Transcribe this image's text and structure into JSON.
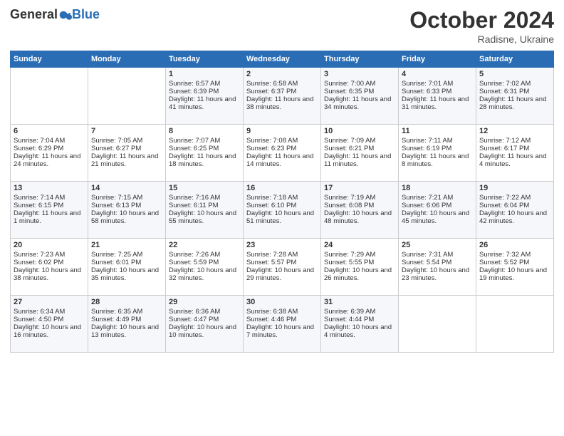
{
  "header": {
    "logo_general": "General",
    "logo_blue": "Blue",
    "month_title": "October 2024",
    "location": "Radisne, Ukraine"
  },
  "days_of_week": [
    "Sunday",
    "Monday",
    "Tuesday",
    "Wednesday",
    "Thursday",
    "Friday",
    "Saturday"
  ],
  "weeks": [
    [
      {
        "day": "",
        "sunrise": "",
        "sunset": "",
        "daylight": ""
      },
      {
        "day": "",
        "sunrise": "",
        "sunset": "",
        "daylight": ""
      },
      {
        "day": "1",
        "sunrise": "Sunrise: 6:57 AM",
        "sunset": "Sunset: 6:39 PM",
        "daylight": "Daylight: 11 hours and 41 minutes."
      },
      {
        "day": "2",
        "sunrise": "Sunrise: 6:58 AM",
        "sunset": "Sunset: 6:37 PM",
        "daylight": "Daylight: 11 hours and 38 minutes."
      },
      {
        "day": "3",
        "sunrise": "Sunrise: 7:00 AM",
        "sunset": "Sunset: 6:35 PM",
        "daylight": "Daylight: 11 hours and 34 minutes."
      },
      {
        "day": "4",
        "sunrise": "Sunrise: 7:01 AM",
        "sunset": "Sunset: 6:33 PM",
        "daylight": "Daylight: 11 hours and 31 minutes."
      },
      {
        "day": "5",
        "sunrise": "Sunrise: 7:02 AM",
        "sunset": "Sunset: 6:31 PM",
        "daylight": "Daylight: 11 hours and 28 minutes."
      }
    ],
    [
      {
        "day": "6",
        "sunrise": "Sunrise: 7:04 AM",
        "sunset": "Sunset: 6:29 PM",
        "daylight": "Daylight: 11 hours and 24 minutes."
      },
      {
        "day": "7",
        "sunrise": "Sunrise: 7:05 AM",
        "sunset": "Sunset: 6:27 PM",
        "daylight": "Daylight: 11 hours and 21 minutes."
      },
      {
        "day": "8",
        "sunrise": "Sunrise: 7:07 AM",
        "sunset": "Sunset: 6:25 PM",
        "daylight": "Daylight: 11 hours and 18 minutes."
      },
      {
        "day": "9",
        "sunrise": "Sunrise: 7:08 AM",
        "sunset": "Sunset: 6:23 PM",
        "daylight": "Daylight: 11 hours and 14 minutes."
      },
      {
        "day": "10",
        "sunrise": "Sunrise: 7:09 AM",
        "sunset": "Sunset: 6:21 PM",
        "daylight": "Daylight: 11 hours and 11 minutes."
      },
      {
        "day": "11",
        "sunrise": "Sunrise: 7:11 AM",
        "sunset": "Sunset: 6:19 PM",
        "daylight": "Daylight: 11 hours and 8 minutes."
      },
      {
        "day": "12",
        "sunrise": "Sunrise: 7:12 AM",
        "sunset": "Sunset: 6:17 PM",
        "daylight": "Daylight: 11 hours and 4 minutes."
      }
    ],
    [
      {
        "day": "13",
        "sunrise": "Sunrise: 7:14 AM",
        "sunset": "Sunset: 6:15 PM",
        "daylight": "Daylight: 11 hours and 1 minute."
      },
      {
        "day": "14",
        "sunrise": "Sunrise: 7:15 AM",
        "sunset": "Sunset: 6:13 PM",
        "daylight": "Daylight: 10 hours and 58 minutes."
      },
      {
        "day": "15",
        "sunrise": "Sunrise: 7:16 AM",
        "sunset": "Sunset: 6:11 PM",
        "daylight": "Daylight: 10 hours and 55 minutes."
      },
      {
        "day": "16",
        "sunrise": "Sunrise: 7:18 AM",
        "sunset": "Sunset: 6:10 PM",
        "daylight": "Daylight: 10 hours and 51 minutes."
      },
      {
        "day": "17",
        "sunrise": "Sunrise: 7:19 AM",
        "sunset": "Sunset: 6:08 PM",
        "daylight": "Daylight: 10 hours and 48 minutes."
      },
      {
        "day": "18",
        "sunrise": "Sunrise: 7:21 AM",
        "sunset": "Sunset: 6:06 PM",
        "daylight": "Daylight: 10 hours and 45 minutes."
      },
      {
        "day": "19",
        "sunrise": "Sunrise: 7:22 AM",
        "sunset": "Sunset: 6:04 PM",
        "daylight": "Daylight: 10 hours and 42 minutes."
      }
    ],
    [
      {
        "day": "20",
        "sunrise": "Sunrise: 7:23 AM",
        "sunset": "Sunset: 6:02 PM",
        "daylight": "Daylight: 10 hours and 38 minutes."
      },
      {
        "day": "21",
        "sunrise": "Sunrise: 7:25 AM",
        "sunset": "Sunset: 6:01 PM",
        "daylight": "Daylight: 10 hours and 35 minutes."
      },
      {
        "day": "22",
        "sunrise": "Sunrise: 7:26 AM",
        "sunset": "Sunset: 5:59 PM",
        "daylight": "Daylight: 10 hours and 32 minutes."
      },
      {
        "day": "23",
        "sunrise": "Sunrise: 7:28 AM",
        "sunset": "Sunset: 5:57 PM",
        "daylight": "Daylight: 10 hours and 29 minutes."
      },
      {
        "day": "24",
        "sunrise": "Sunrise: 7:29 AM",
        "sunset": "Sunset: 5:55 PM",
        "daylight": "Daylight: 10 hours and 26 minutes."
      },
      {
        "day": "25",
        "sunrise": "Sunrise: 7:31 AM",
        "sunset": "Sunset: 5:54 PM",
        "daylight": "Daylight: 10 hours and 23 minutes."
      },
      {
        "day": "26",
        "sunrise": "Sunrise: 7:32 AM",
        "sunset": "Sunset: 5:52 PM",
        "daylight": "Daylight: 10 hours and 19 minutes."
      }
    ],
    [
      {
        "day": "27",
        "sunrise": "Sunrise: 6:34 AM",
        "sunset": "Sunset: 4:50 PM",
        "daylight": "Daylight: 10 hours and 16 minutes."
      },
      {
        "day": "28",
        "sunrise": "Sunrise: 6:35 AM",
        "sunset": "Sunset: 4:49 PM",
        "daylight": "Daylight: 10 hours and 13 minutes."
      },
      {
        "day": "29",
        "sunrise": "Sunrise: 6:36 AM",
        "sunset": "Sunset: 4:47 PM",
        "daylight": "Daylight: 10 hours and 10 minutes."
      },
      {
        "day": "30",
        "sunrise": "Sunrise: 6:38 AM",
        "sunset": "Sunset: 4:46 PM",
        "daylight": "Daylight: 10 hours and 7 minutes."
      },
      {
        "day": "31",
        "sunrise": "Sunrise: 6:39 AM",
        "sunset": "Sunset: 4:44 PM",
        "daylight": "Daylight: 10 hours and 4 minutes."
      },
      {
        "day": "",
        "sunrise": "",
        "sunset": "",
        "daylight": ""
      },
      {
        "day": "",
        "sunrise": "",
        "sunset": "",
        "daylight": ""
      }
    ]
  ]
}
